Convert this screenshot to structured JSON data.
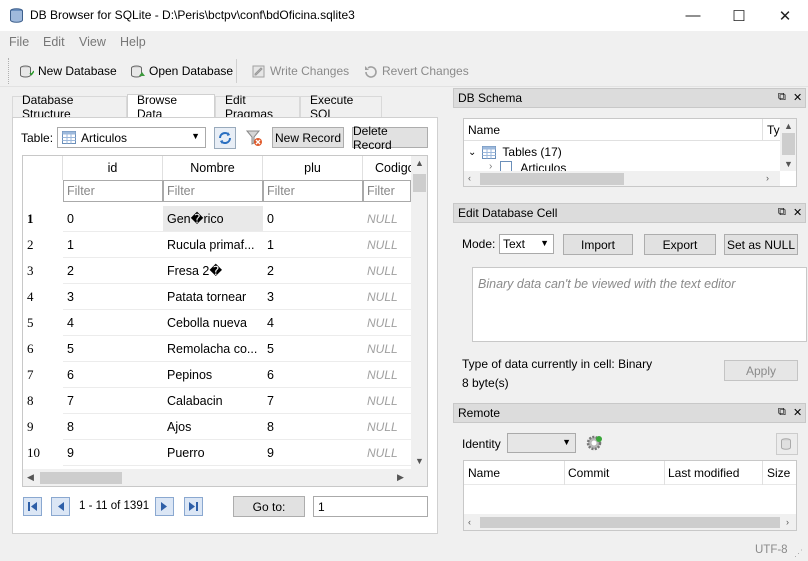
{
  "window": {
    "title": "DB Browser for SQLite - D:\\Peris\\bctpv\\conf\\bdOficina.sqlite3",
    "minimize_glyph": "—",
    "maximize_glyph": "☐",
    "close_glyph": "✕"
  },
  "menu": [
    "File",
    "Edit",
    "View",
    "Help"
  ],
  "toolbar": {
    "new_database": "New Database",
    "open_database": "Open Database",
    "write_changes": "Write Changes",
    "revert_changes": "Revert Changes"
  },
  "tabs": [
    "Database Structure",
    "Browse Data",
    "Edit Pragmas",
    "Execute SQL"
  ],
  "browse": {
    "table_label": "Table:",
    "table_value": "Articulos",
    "new_record": "New Record",
    "delete_record": "Delete Record",
    "columns": [
      "id",
      "Nombre",
      "plu",
      "Codigo"
    ],
    "filter_placeholder": "Filter",
    "rows": [
      {
        "num": "1",
        "id": "0",
        "nombre": "Gen�rico",
        "plu": "0",
        "codigo": "NULL"
      },
      {
        "num": "2",
        "id": "1",
        "nombre": "Rucula primaf...",
        "plu": "1",
        "codigo": "NULL"
      },
      {
        "num": "3",
        "id": "2",
        "nombre": "Fresa 2�",
        "plu": "2",
        "codigo": "NULL"
      },
      {
        "num": "4",
        "id": "3",
        "nombre": "Patata tornear",
        "plu": "3",
        "codigo": "NULL"
      },
      {
        "num": "5",
        "id": "4",
        "nombre": "Cebolla nueva",
        "plu": "4",
        "codigo": "NULL"
      },
      {
        "num": "6",
        "id": "5",
        "nombre": "Remolacha co...",
        "plu": "5",
        "codigo": "NULL"
      },
      {
        "num": "7",
        "id": "6",
        "nombre": "Pepinos",
        "plu": "6",
        "codigo": "NULL"
      },
      {
        "num": "8",
        "id": "7",
        "nombre": "Calabacin",
        "plu": "7",
        "codigo": "NULL"
      },
      {
        "num": "9",
        "id": "8",
        "nombre": "Ajos",
        "plu": "8",
        "codigo": "NULL"
      },
      {
        "num": "10",
        "id": "9",
        "nombre": "Puerro",
        "plu": "9",
        "codigo": "NULL"
      }
    ],
    "record_info": "1 - 11 of 1391",
    "goto_label": "Go to:",
    "goto_value": "1"
  },
  "schema": {
    "title": "DB Schema",
    "col_name": "Name",
    "col_type": "Ty",
    "tables_node": "Tables (17)",
    "child_node": "Articulos"
  },
  "edit_cell": {
    "title": "Edit Database Cell",
    "mode_label": "Mode:",
    "mode_value": "Text",
    "import": "Import",
    "export": "Export",
    "set_null": "Set as NULL",
    "editor_message": "Binary data can't be viewed with the text editor",
    "type_info": "Type of data currently in cell: Binary",
    "size_info": "8 byte(s)",
    "apply": "Apply"
  },
  "remote": {
    "title": "Remote",
    "identity_label": "Identity",
    "columns": [
      "Name",
      "Commit",
      "Last modified",
      "Size"
    ]
  },
  "statusbar": {
    "encoding": "UTF-8"
  }
}
